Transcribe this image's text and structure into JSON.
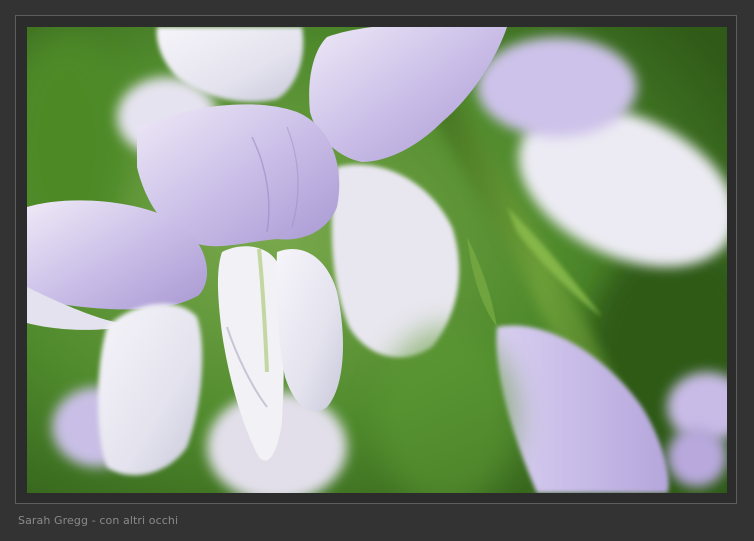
{
  "caption": {
    "text": "Sarah Gregg - con altri occhi"
  },
  "photo": {
    "subject": "lavender-flower-macro"
  },
  "colors": {
    "background": "#333333",
    "frame_border": "#5e5e5e",
    "caption_text": "#8a8a8a",
    "foliage": "#3f6e22",
    "petal_lilac": "#c7bde6",
    "petal_white": "#ecebf2"
  }
}
